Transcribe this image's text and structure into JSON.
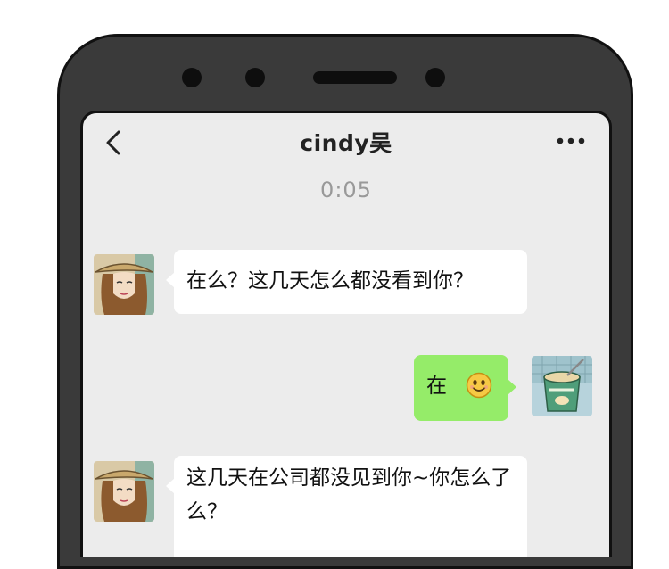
{
  "header": {
    "contact_name": "cindy吴"
  },
  "call": {
    "duration": "0:05"
  },
  "messages": [
    {
      "side": "left",
      "text": "在么？这几天怎么都没看到你？"
    },
    {
      "side": "right",
      "text": "在",
      "emoji": "smiley-face"
    },
    {
      "side": "left",
      "text": "这几天在公司都没见到你~你怎么了么？"
    }
  ],
  "colors": {
    "screen_bg": "#ececec",
    "incoming_bubble": "#ffffff",
    "outgoing_bubble": "#95ec69",
    "phone_frame": "#3a3a3a"
  }
}
